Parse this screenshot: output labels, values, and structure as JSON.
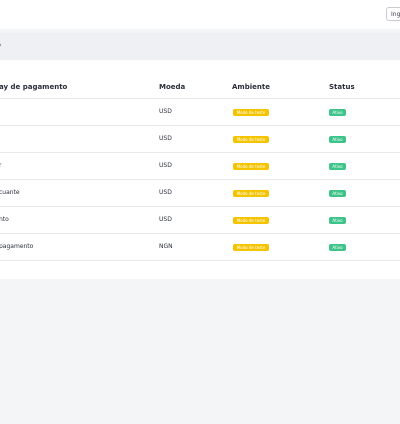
{
  "topbar": {
    "language_label": "Ingl"
  },
  "card": {
    "title": "o"
  },
  "table": {
    "columns": [
      "ay de pagamento",
      "Moeda",
      "Ambiente",
      "Status"
    ],
    "rows": [
      {
        "name": "",
        "currency": "USD",
        "environment": "Modo de teste",
        "status": "Ativo"
      },
      {
        "name": "",
        "currency": "USD",
        "environment": "Modo de teste",
        "status": "Ativo"
      },
      {
        "name": "r",
        "currency": "USD",
        "environment": "Modo de teste",
        "status": "Ativo"
      },
      {
        "name": "cuante",
        "currency": "USD",
        "environment": "Modo de teste",
        "status": "Ativo"
      },
      {
        "name": "nto",
        "currency": "USD",
        "environment": "Modo de teste",
        "status": "Ativo"
      },
      {
        "name": "pagamento",
        "currency": "NGN",
        "environment": "Modo de teste",
        "status": "Ativo"
      }
    ]
  },
  "colors": {
    "environment_badge": "#f5c400",
    "status_badge": "#3ec48a"
  }
}
